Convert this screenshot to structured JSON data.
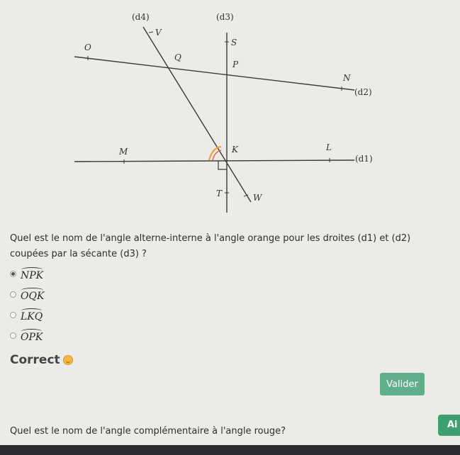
{
  "figure": {
    "labels": {
      "d4": "(d4)",
      "d3": "(d3)",
      "d2": "(d2)",
      "d1": "(d1)",
      "V": "V",
      "S": "S",
      "O": "O",
      "Q": "Q",
      "P": "P",
      "N": "N",
      "M": "M",
      "K": "K",
      "L": "L",
      "T": "T",
      "W": "W"
    },
    "colors": {
      "lines": "#333333",
      "arc": "#f2a33a"
    }
  },
  "question": {
    "text": "Quel est le nom de l'angle alterne-interne à l'angle orange pour les droites (d1) et (d2) coupées par la sécante (d3) ?"
  },
  "options": [
    {
      "label": "NPK",
      "selected": true
    },
    {
      "label": "OQK",
      "selected": false
    },
    {
      "label": "LKQ",
      "selected": false
    },
    {
      "label": "OPK",
      "selected": false
    }
  ],
  "feedback": {
    "text": "Correct",
    "icon": "grinning-face-icon"
  },
  "buttons": {
    "validate": "Valider",
    "help": "Ai"
  },
  "next_question": {
    "text": "Quel est le nom de l'angle complémentaire à l'angle rouge?"
  }
}
